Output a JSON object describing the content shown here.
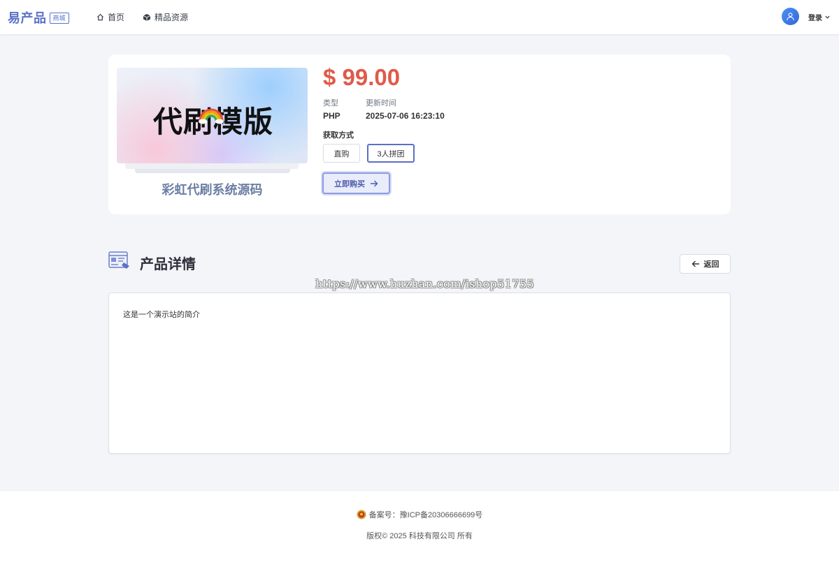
{
  "header": {
    "brand_name": "易产品",
    "brand_badge": "商城",
    "nav": [
      {
        "label": "首页",
        "icon": "home-icon"
      },
      {
        "label": "精品资源",
        "icon": "cube-icon"
      }
    ],
    "login_label": "登录"
  },
  "product": {
    "image_text": "代刷模版",
    "name": "彩虹代刷系统源码",
    "price": "$ 99.00",
    "type_label": "类型",
    "type_value": "PHP",
    "update_label": "更新时间",
    "update_value": "2025-07-06 16:23:10",
    "acquire_label": "获取方式",
    "options": [
      "直购",
      "3人拼团"
    ],
    "selected_option": "3人拼团",
    "buy_label": "立即购买"
  },
  "detail": {
    "section_title": "产品详情",
    "back_label": "返回",
    "watermark": "https://www.huzhan.com/ishop51755",
    "description": "这是一个演示站的简介"
  },
  "footer": {
    "icp_label": "备案号：",
    "icp_number": "豫ICP备20306666699号",
    "copyright": "版权© 2025 科技有限公司 所有"
  },
  "colors": {
    "brand": "#5a73c9",
    "price": "#e05a4a",
    "accent": "#5a6fc8"
  }
}
